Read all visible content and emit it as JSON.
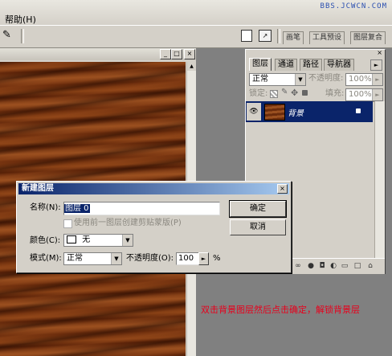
{
  "menubar": {
    "help": "帮助(H)",
    "watermark": "BBS.JCWCN.COM"
  },
  "toolbar": {
    "well_tabs": [
      "画笔",
      "工具预设",
      "图层复合"
    ]
  },
  "document_window": {
    "buttons": [
      "_",
      "□",
      "×"
    ]
  },
  "layers_palette": {
    "tabs": [
      "图层",
      "通道",
      "路径",
      "导航器"
    ],
    "blend_mode": "正常",
    "opacity_label": "不透明度:",
    "opacity_value": "100%",
    "lock_label": "锁定:",
    "fill_label": "填充:",
    "fill_value": "100%",
    "layer_name": "背景"
  },
  "dialog": {
    "title": "新建图层",
    "name_label": "名称(N):",
    "name_value": "图层 0",
    "clip_label": "使用前一图层创建剪贴蒙版(P)",
    "color_label": "颜色(C):",
    "color_value": "无",
    "mode_label": "模式(M):",
    "mode_value": "正常",
    "opacity_label": "不透明度(O):",
    "opacity_value": "100",
    "opacity_unit": "%",
    "ok_label": "确定",
    "cancel_label": "取消"
  },
  "annotation": "双击背景图层然后点击确定，解锁背景层",
  "colors": {
    "title_blue": "#0a246a",
    "note_red": "#e8001c",
    "wood": "#6b2c0c"
  }
}
